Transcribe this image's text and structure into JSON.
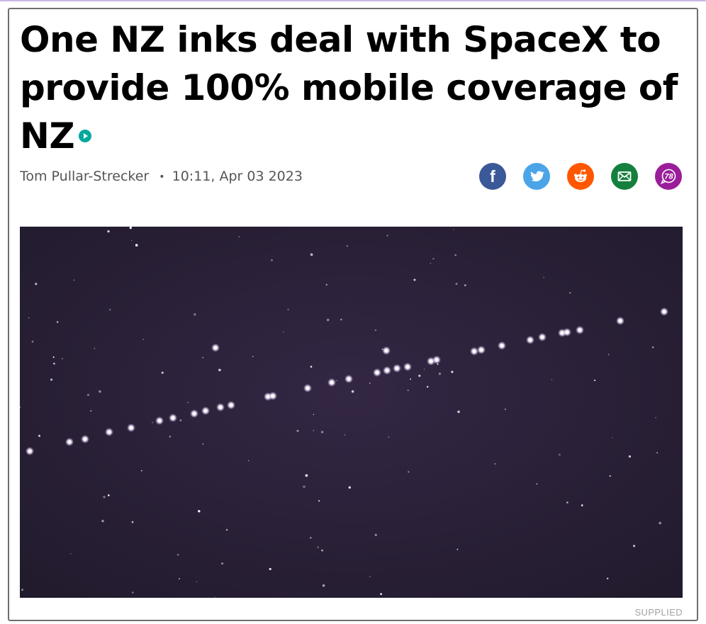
{
  "article": {
    "title": "One NZ inks deal with SpaceX to provide 100% mobile coverage of NZ",
    "author": "Tom Pullar-Strecker",
    "separator": "•",
    "timestamp": "10:11, Apr 03 2023",
    "photo_credit": "SUPPLIED"
  },
  "share": [
    {
      "name": "facebook-icon",
      "color": "#3b5998"
    },
    {
      "name": "twitter-icon",
      "color": "#4ba4e8"
    },
    {
      "name": "reddit-icon",
      "color": "#ff5700"
    },
    {
      "name": "email-icon",
      "color": "#15803d"
    },
    {
      "name": "comments-icon",
      "color": "#9a1e9a",
      "count": "78"
    }
  ],
  "colors": {
    "play_badge": "#00a99d",
    "photo_background": "#2a2036"
  }
}
